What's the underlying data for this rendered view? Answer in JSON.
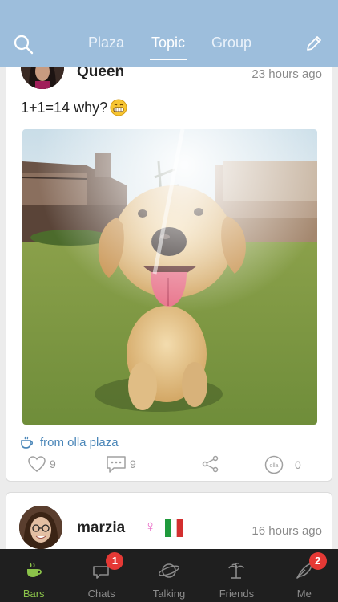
{
  "header": {
    "tabs": [
      {
        "label": "Plaza"
      },
      {
        "label": "Topic"
      },
      {
        "label": "Group"
      }
    ],
    "active_tab": "Topic",
    "bg_color": "#9dbedc"
  },
  "posts": [
    {
      "username": "Queen",
      "time": "23 hours ago",
      "text": "1+1=14 why?",
      "emoji": "grinning-face-icon",
      "source": "from olla plaza",
      "likes": "9",
      "comments": "9",
      "olla_count": "0"
    },
    {
      "username": "marzia",
      "time": "16 hours ago",
      "gender": "♀",
      "flag": "italy-flag-icon"
    }
  ],
  "bottom_nav": {
    "items": [
      {
        "label": "Bars",
        "icon": "cup-icon"
      },
      {
        "label": "Chats",
        "icon": "chat-bubble-icon",
        "badge": "1"
      },
      {
        "label": "Talking",
        "icon": "planet-icon"
      },
      {
        "label": "Friends",
        "icon": "palm-tree-icon"
      },
      {
        "label": "Me",
        "icon": "feather-icon",
        "badge": "2"
      }
    ],
    "active": "Bars"
  },
  "colors": {
    "accent": "#8bc34a",
    "link": "#4a86b8",
    "badge": "#e53935"
  }
}
